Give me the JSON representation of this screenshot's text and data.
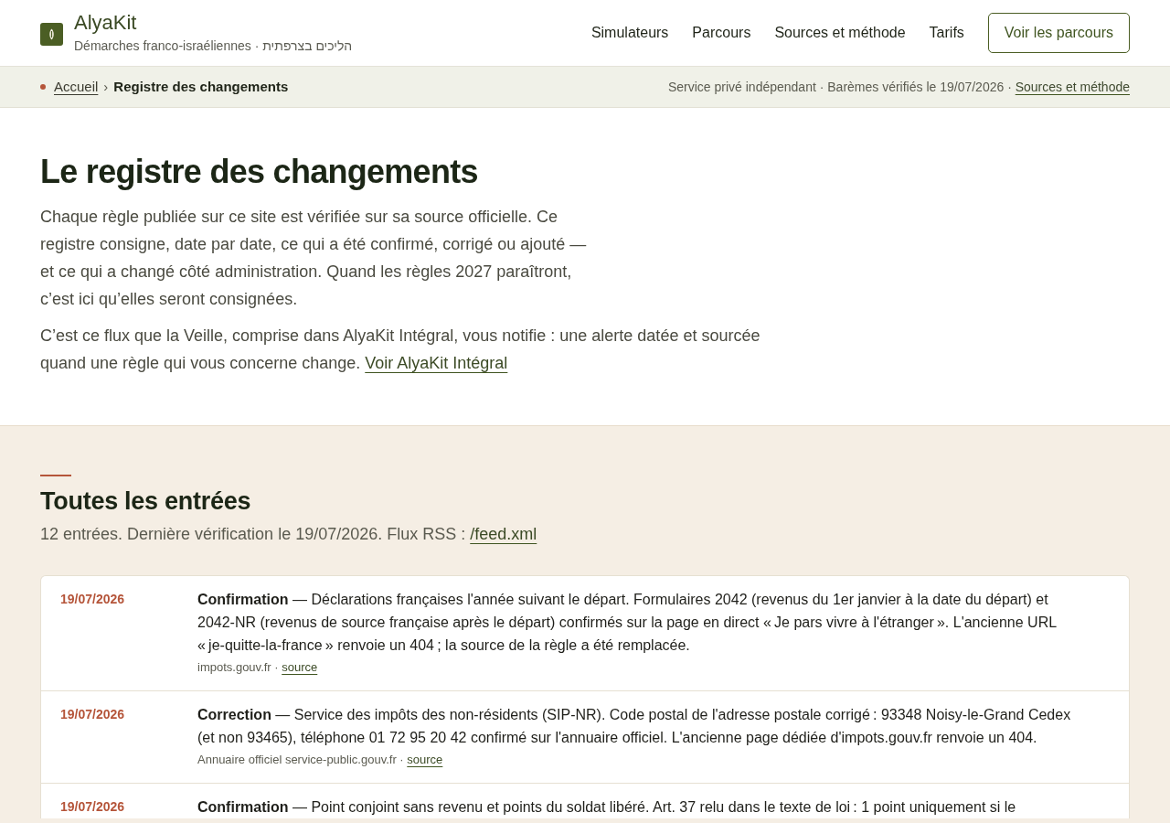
{
  "header": {
    "brand": "AlyaKit",
    "tagline": "Démarches franco-israéliennes · הליכים בצרפתית",
    "nav": [
      {
        "label": "Simulateurs"
      },
      {
        "label": "Parcours"
      },
      {
        "label": "Sources et méthode"
      },
      {
        "label": "Tarifs"
      }
    ],
    "cta": "Voir les parcours"
  },
  "breadcrumb": {
    "items": [
      {
        "label": "Accueil",
        "kind": "link"
      },
      {
        "label": "›",
        "kind": "separator"
      },
      {
        "label": "Registre des changements",
        "kind": "current"
      }
    ],
    "notice": "Service privé indépendant · Barèmes vérifiés le 19/07/2026 · ",
    "notice_link": "Sources et méthode"
  },
  "intro": {
    "title": "Le registre des changements",
    "paragraphs": [
      {
        "text": "Chaque règle publiée sur ce site est vérifiée sur sa source officielle. Ce registre consigne, date par date, ce qui a été confirmé, corrigé ou ajouté — et ce qui a changé côté administration. Quand les règles 2027 paraîtront, c’est ici qu’elles seront consignées."
      },
      {
        "text": "C’est ce flux que la Veille, comprise dans AlyaKit Intégral, vous notifie : une alerte datée et sourcée quand une règle qui vous concerne change. ",
        "link": "Voir AlyaKit Intégral"
      }
    ]
  },
  "entries_section": {
    "title": "Toutes les entrées",
    "summary": "12 entrées. Dernière vérification le 19/07/2026. Flux RSS : ",
    "feed_link": "/feed.xml",
    "entries": [
      {
        "date": "19/07/2026",
        "text": "**Confirmation** — Déclarations françaises l'année suivant le départ. Formulaires 2042 (revenus du 1er janvier à la date du départ) et 2042-NR (revenus de source française après le départ) confirmés sur la page en direct « Je pars vivre à l'étranger ». L'ancienne URL « je-quitte-la-france » renvoie un 404 ; la source de la règle a été remplacée.",
        "source": "impots.gouv.fr · ",
        "link": "source"
      },
      {
        "date": "19/07/2026",
        "text": "**Correction** — Service des impôts des non-résidents (SIP-NR). Code postal de l'adresse postale corrigé : 93348 Noisy-le-Grand Cedex (et non 93465), téléphone 01 72 95 20 42 confirmé sur l'annuaire officiel. L'ancienne page dédiée d'impots.gouv.fr renvoie un 404.",
        "source": "Annuaire officiel service-public.gouv.fr · ",
        "link": "source"
      },
      {
        "date": "19/07/2026",
        "text": "**Confirmation** — Point conjoint sans revenu et points du soldat libéré. Art. 37 relu dans le texte de loi : 1 point uniquement si le"
      }
    ]
  }
}
